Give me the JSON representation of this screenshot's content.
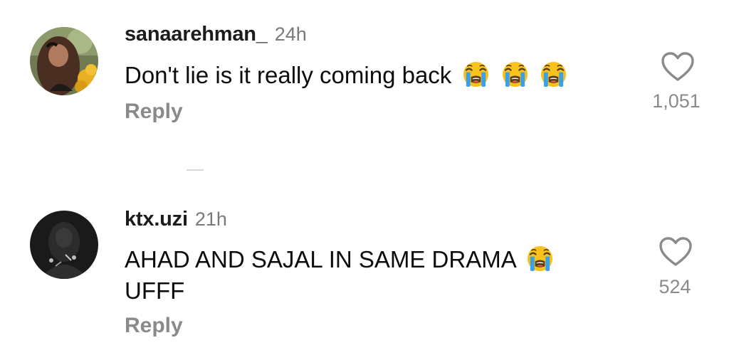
{
  "comments": [
    {
      "username": "sanaarehman_",
      "time": "24h",
      "text": "Don't lie is it really coming back",
      "emoji": [
        "loudly-crying-face",
        "loudly-crying-face",
        "loudly-crying-face"
      ],
      "reply_label": "Reply",
      "likes": "1,051",
      "avatar": "profile photo of a woman with yellow flowers"
    },
    {
      "username": "ktx.uzi",
      "time": "21h",
      "text": "AHAD AND SAJAL IN SAME DRAMA",
      "text_line2": "UFFF",
      "emoji": [
        "loudly-crying-face"
      ],
      "reply_label": "Reply",
      "likes": "524",
      "avatar": "black and white profile photo"
    }
  ],
  "colors": {
    "username": "#1c1c1c",
    "timestamp": "#7a7a7a",
    "secondary": "#8a8a8a",
    "emoji_face": "#f7c21b",
    "emoji_tears": "#3aa0e8"
  },
  "icons": {
    "like": "heart-outline-icon",
    "emoji": "loudly-crying-face-emoji"
  }
}
